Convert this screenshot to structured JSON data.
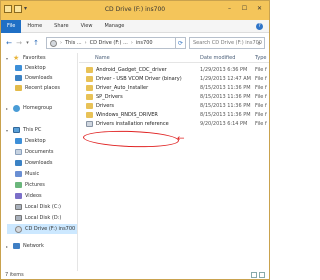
{
  "window": {
    "title": "CD Drive (F:) ins700",
    "controls": {
      "minimize": "–",
      "maximize": "☐",
      "close": "✕"
    }
  },
  "ribbon": {
    "file_tab": "File",
    "tabs": [
      "Home",
      "Share",
      "View",
      "Manage"
    ]
  },
  "address": {
    "back": "←",
    "forward": "→",
    "recent": "▾",
    "up": "↑",
    "path": [
      "This ...",
      "CD Drive (F:) ...",
      "ins700"
    ],
    "refresh": "⟳",
    "search_placeholder": "Search CD Drive (F:) ins700"
  },
  "nav": {
    "favorites": "Favorites",
    "desktop": "Desktop",
    "downloads": "Downloads",
    "recent_places": "Recent places",
    "homegroup": "Homegroup",
    "this_pc": "This PC",
    "desktop2": "Desktop",
    "documents": "Documents",
    "downloads2": "Downloads",
    "music": "Music",
    "pictures": "Pictures",
    "videos": "Videos",
    "local_c": "Local Disk (C:)",
    "local_d": "Local Disk (D:)",
    "cd_drive": "CD Drive (F:) ins700",
    "network": "Network"
  },
  "columns": {
    "name": "Name",
    "date": "Date modified",
    "type": "Type"
  },
  "files": [
    {
      "name": "Android_Gadget_CDC_driver",
      "date": "1/29/2013 6:36 PM",
      "type": "File f"
    },
    {
      "name": "Driver - USB VCOM Driver (binary)",
      "date": "1/29/2013 12:47 AM",
      "type": "File f"
    },
    {
      "name": "Driver_Auto_Installer",
      "date": "8/15/2013 11:36 PM",
      "type": "File f"
    },
    {
      "name": "SP_Drivers",
      "date": "8/15/2013 11:36 PM",
      "type": "File f"
    },
    {
      "name": "Drivers",
      "date": "8/15/2013 11:36 PM",
      "type": "File f"
    },
    {
      "name": "Windows_RNDIS_DRIVER",
      "date": "8/15/2013 11:36 PM",
      "type": "File f"
    },
    {
      "name": "Drivers installation reference",
      "date": "9/20/2013 6:14 PM",
      "type": "File f"
    }
  ],
  "annotation": {
    "arrow": "←"
  },
  "status": {
    "text": "7 items"
  },
  "colors": {
    "titlebar": "#f4c55a",
    "file_tab": "#1f6fc5",
    "annotation": "#e02424",
    "folder": "#e8c257"
  }
}
